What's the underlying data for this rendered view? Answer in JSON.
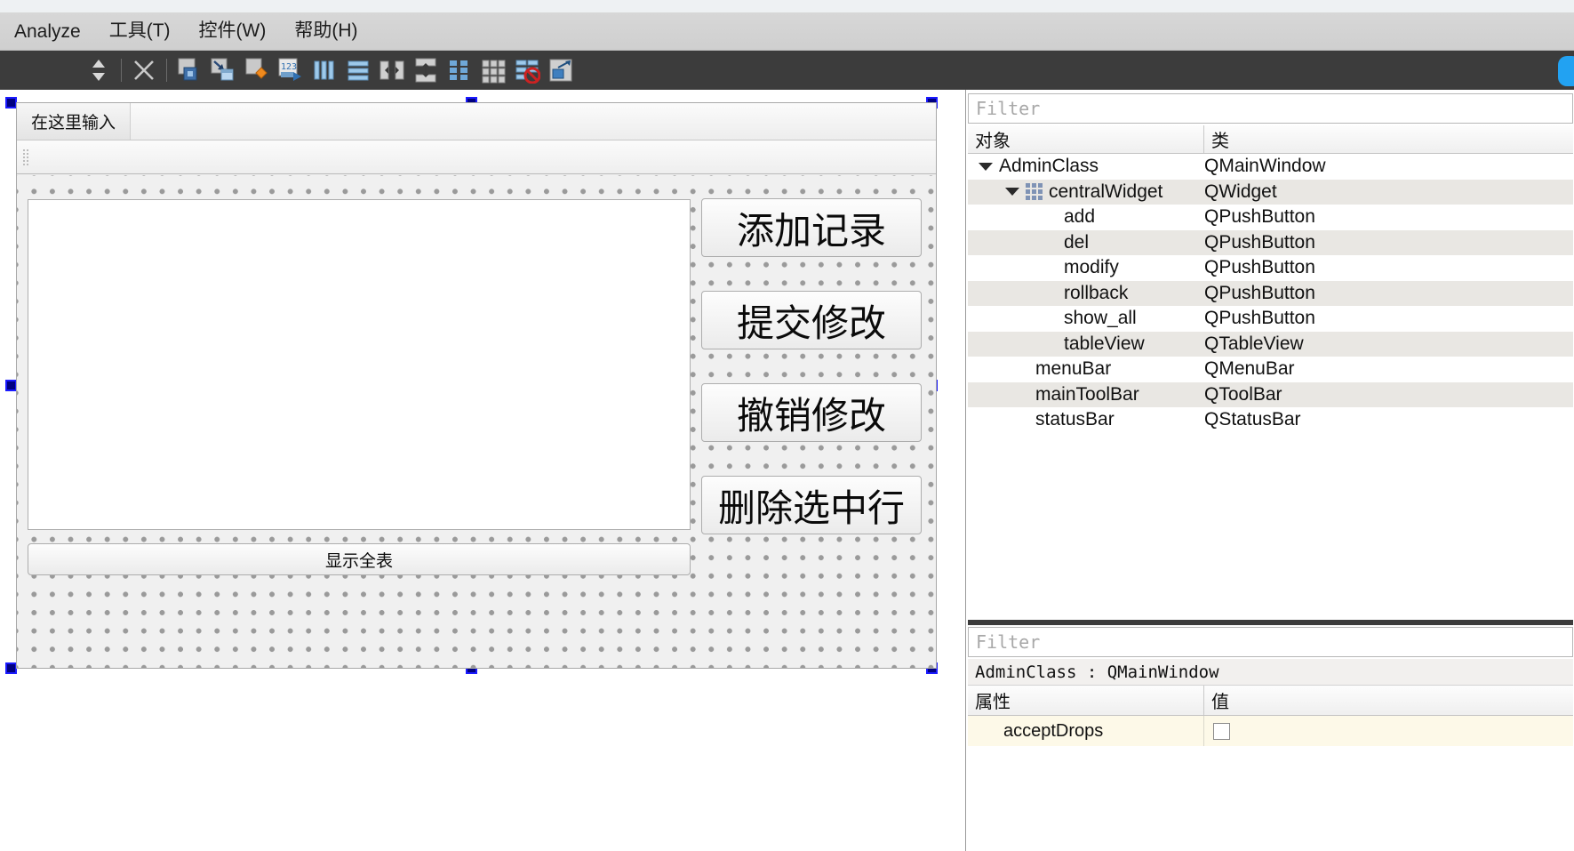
{
  "menubar": {
    "items": [
      {
        "label": "Analyze",
        "name": "menu-analyze"
      },
      {
        "label": "工具(T)",
        "name": "menu-tools"
      },
      {
        "label": "控件(W)",
        "name": "menu-widgets"
      },
      {
        "label": "帮助(H)",
        "name": "menu-help"
      }
    ]
  },
  "toolbar": {
    "buttons": [
      {
        "name": "spin-updown-icon",
        "title": "上下调整"
      },
      {
        "name": "separator",
        "title": ""
      },
      {
        "name": "close-x-icon",
        "title": "关闭"
      },
      {
        "name": "separator2",
        "title": ""
      },
      {
        "name": "edit-widgets-icon",
        "title": "编辑控件"
      },
      {
        "name": "edit-signals-slots-icon",
        "title": "编辑信号/槽"
      },
      {
        "name": "edit-buddies-icon",
        "title": "编辑伙伴"
      },
      {
        "name": "edit-tab-order-icon",
        "title": "编辑Tab顺序"
      },
      {
        "name": "layout-horizontally-icon",
        "title": "水平布局"
      },
      {
        "name": "layout-vertically-icon",
        "title": "垂直布局"
      },
      {
        "name": "layout-splitter-horizontal-icon",
        "title": "使用分裂器水平布局"
      },
      {
        "name": "layout-splitter-vertical-icon",
        "title": "使用分裂器垂直布局"
      },
      {
        "name": "layout-form-icon",
        "title": "表单布局"
      },
      {
        "name": "layout-grid-icon",
        "title": "栅格布局"
      },
      {
        "name": "break-layout-icon",
        "title": "打破布局"
      },
      {
        "name": "adjust-size-icon",
        "title": "调整大小"
      }
    ],
    "accent_pill_color": "#22a2f2"
  },
  "form": {
    "menubar_placeholder": "在这里输入",
    "tableview_name": "tableView",
    "buttons": [
      {
        "label": "添加记录",
        "object": "add",
        "name": "form-button-add"
      },
      {
        "label": "提交修改",
        "object": "modify",
        "name": "form-button-modify"
      },
      {
        "label": "撤销修改",
        "object": "rollback",
        "name": "form-button-rollback"
      },
      {
        "label": "删除选中行",
        "object": "del",
        "name": "form-button-del"
      }
    ],
    "wide_button": {
      "label": "显示全表",
      "object": "show_all",
      "name": "form-button-show-all"
    }
  },
  "object_inspector": {
    "filter_placeholder": "Filter",
    "columns": [
      "对象",
      "类"
    ],
    "rows": [
      {
        "name": "AdminClass",
        "class": "QMainWindow",
        "indent": 0,
        "arrow": true,
        "icon": false
      },
      {
        "name": "centralWidget",
        "class": "QWidget",
        "indent": 1,
        "arrow": true,
        "icon": true
      },
      {
        "name": "add",
        "class": "QPushButton",
        "indent": 3,
        "arrow": false,
        "icon": false
      },
      {
        "name": "del",
        "class": "QPushButton",
        "indent": 3,
        "arrow": false,
        "icon": false
      },
      {
        "name": "modify",
        "class": "QPushButton",
        "indent": 3,
        "arrow": false,
        "icon": false
      },
      {
        "name": "rollback",
        "class": "QPushButton",
        "indent": 3,
        "arrow": false,
        "icon": false
      },
      {
        "name": "show_all",
        "class": "QPushButton",
        "indent": 3,
        "arrow": false,
        "icon": false
      },
      {
        "name": "tableView",
        "class": "QTableView",
        "indent": 3,
        "arrow": false,
        "icon": false
      },
      {
        "name": "menuBar",
        "class": "QMenuBar",
        "indent": 2,
        "arrow": false,
        "icon": false
      },
      {
        "name": "mainToolBar",
        "class": "QToolBar",
        "indent": 2,
        "arrow": false,
        "icon": false
      },
      {
        "name": "statusBar",
        "class": "QStatusBar",
        "indent": 2,
        "arrow": false,
        "icon": false
      }
    ]
  },
  "property_editor": {
    "filter_placeholder": "Filter",
    "title": "AdminClass : QMainWindow",
    "columns": [
      "属性",
      "值"
    ],
    "rows": [
      {
        "property": "acceptDrops",
        "value": "",
        "type": "checkbox",
        "checked": false
      }
    ]
  }
}
